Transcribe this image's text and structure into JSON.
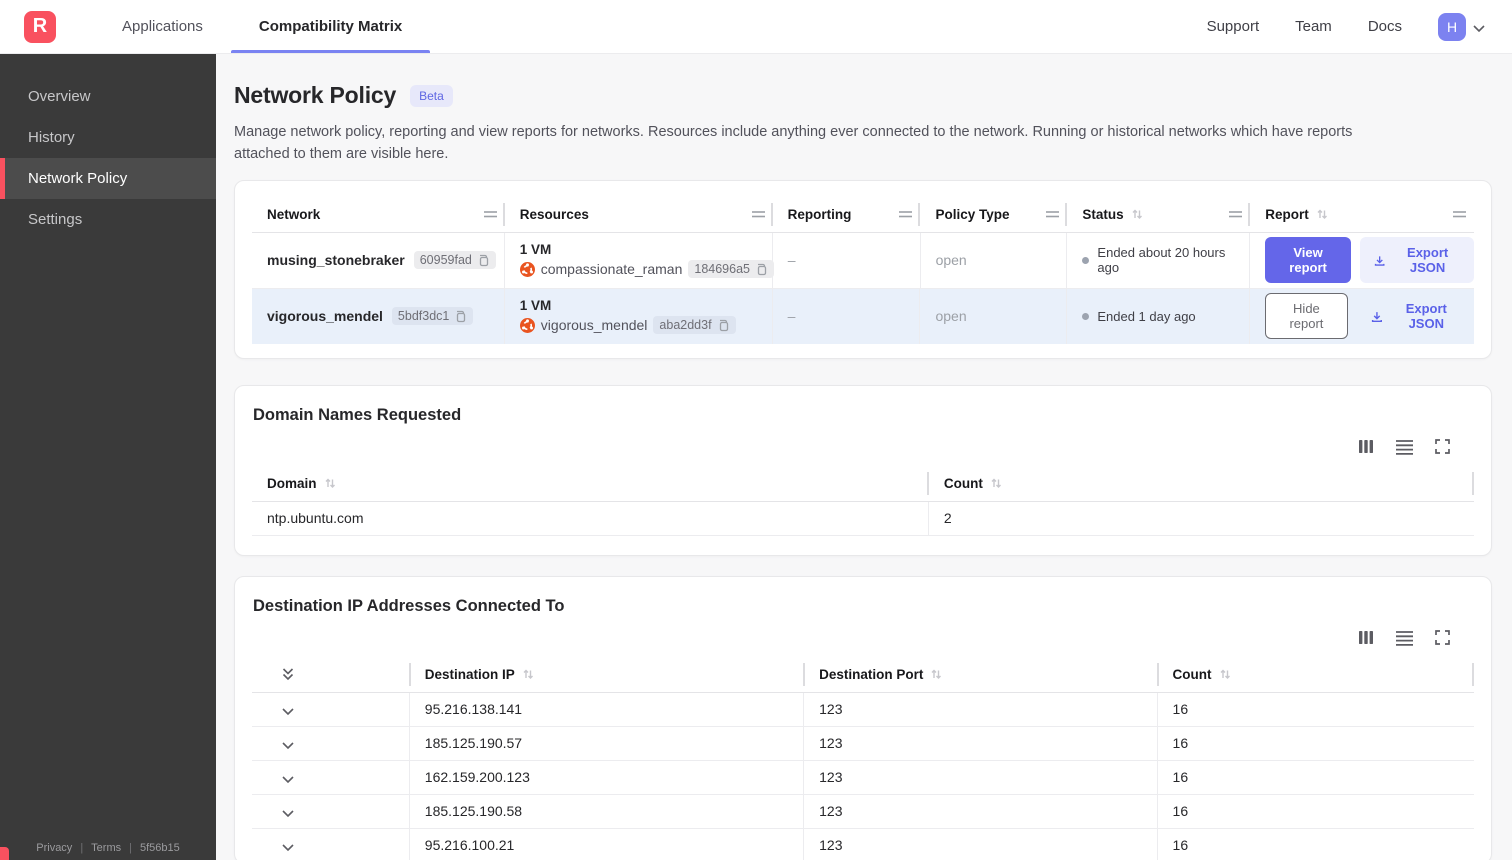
{
  "navbar": {
    "logo_letter": "R",
    "tabs": [
      {
        "label": "Applications"
      },
      {
        "label": "Compatibility Matrix"
      }
    ],
    "links": [
      {
        "label": "Support"
      },
      {
        "label": "Team"
      },
      {
        "label": "Docs"
      }
    ],
    "avatar_letter": "H"
  },
  "sidebar": {
    "items": [
      {
        "label": "Overview"
      },
      {
        "label": "History"
      },
      {
        "label": "Network Policy"
      },
      {
        "label": "Settings"
      }
    ],
    "footer": {
      "privacy": "Privacy",
      "terms": "Terms",
      "build": "5f56b15"
    }
  },
  "page": {
    "title": "Network Policy",
    "beta_badge": "Beta",
    "description": "Manage network policy, reporting and view reports for networks. Resources include anything ever connected to the network. Running or historical networks which have reports attached to them are visible here."
  },
  "network_table": {
    "columns": [
      "Network",
      "Resources",
      "Reporting",
      "Policy Type",
      "Status",
      "Report"
    ],
    "rows": [
      {
        "network_name": "musing_stonebraker",
        "network_id": "60959fad",
        "resources_count": "1 VM",
        "resource_name": "compassionate_raman",
        "resource_id": "184696a5",
        "reporting": "–",
        "policy_type": "open",
        "status": "Ended about 20 hours ago",
        "report_button": "View report",
        "export_button": "Export JSON"
      },
      {
        "network_name": "vigorous_mendel",
        "network_id": "5bdf3dc1",
        "resources_count": "1 VM",
        "resource_name": "vigorous_mendel",
        "resource_id": "aba2dd3f",
        "reporting": "–",
        "policy_type": "open",
        "status": "Ended 1 day ago",
        "report_button": "Hide report",
        "export_button": "Export JSON"
      }
    ]
  },
  "domain_card": {
    "title": "Domain Names Requested",
    "columns": [
      "Domain",
      "Count"
    ],
    "rows": [
      {
        "domain": "ntp.ubuntu.com",
        "count": "2"
      }
    ]
  },
  "destination_card": {
    "title": "Destination IP Addresses Connected To",
    "columns": [
      "Destination IP",
      "Destination Port",
      "Count"
    ],
    "rows": [
      {
        "ip": "95.216.138.141",
        "port": "123",
        "count": "16"
      },
      {
        "ip": "185.125.190.57",
        "port": "123",
        "count": "16"
      },
      {
        "ip": "162.159.200.123",
        "port": "123",
        "count": "16"
      },
      {
        "ip": "185.125.190.58",
        "port": "123",
        "count": "16"
      },
      {
        "ip": "95.216.100.21",
        "port": "123",
        "count": "16"
      }
    ]
  },
  "colors": {
    "accent_indigo": "#6466e9",
    "brand_red": "#f9515f",
    "row_highlight": "#e9f0fa",
    "ubuntu_orange": "#e95420",
    "sidebar_bg": "#3a3a3a"
  }
}
